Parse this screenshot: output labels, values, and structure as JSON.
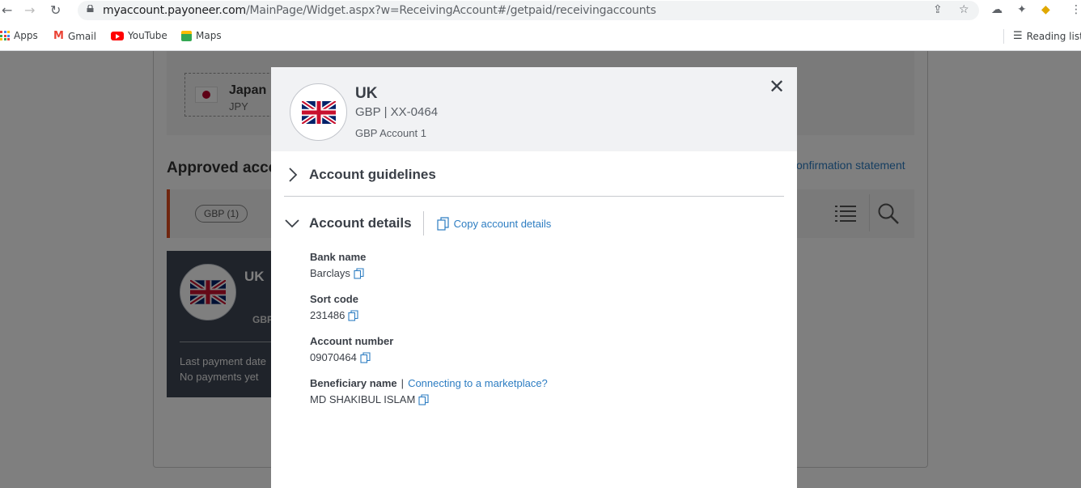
{
  "browser": {
    "url_host": "myaccount.payoneer.com",
    "url_path": "/MainPage/Widget.aspx?w=ReceivingAccount#/getpaid/receivingaccounts",
    "bookmarks": [
      "Apps",
      "Gmail",
      "YouTube",
      "Maps"
    ],
    "reading_list": "Reading list"
  },
  "background_page": {
    "currency_card": {
      "name": "Japan",
      "code": "JPY"
    },
    "approved_heading": "Approved accou",
    "confirmation_link": "onfirmation statement",
    "filter_chip": "GBP (1)",
    "account_card": {
      "country": "UK",
      "currency_fragment": "GBP",
      "last_payment_label": "Last payment date",
      "last_payment_value": "No payments yet"
    }
  },
  "modal": {
    "country": "UK",
    "currency": "GBP",
    "separator": "|",
    "masked_account": "XX-0464",
    "account_name": "GBP Account 1",
    "close_glyph": "✕",
    "guidelines_title": "Account guidelines",
    "details_title": "Account details",
    "copy_all_label": "Copy account details",
    "fields": {
      "bank_name": {
        "label": "Bank name",
        "value": "Barclays"
      },
      "sort_code": {
        "label": "Sort code",
        "value": "231486"
      },
      "account_number": {
        "label": "Account number",
        "value": "09070464"
      },
      "beneficiary": {
        "label": "Beneficiary name",
        "link": "Connecting to a marketplace?",
        "value": "MD SHAKIBUL ISLAM"
      }
    }
  },
  "colors": {
    "accent_link": "#2d7dc2",
    "brand_orange": "#e14c1f",
    "text_dark": "#3a3f47"
  }
}
